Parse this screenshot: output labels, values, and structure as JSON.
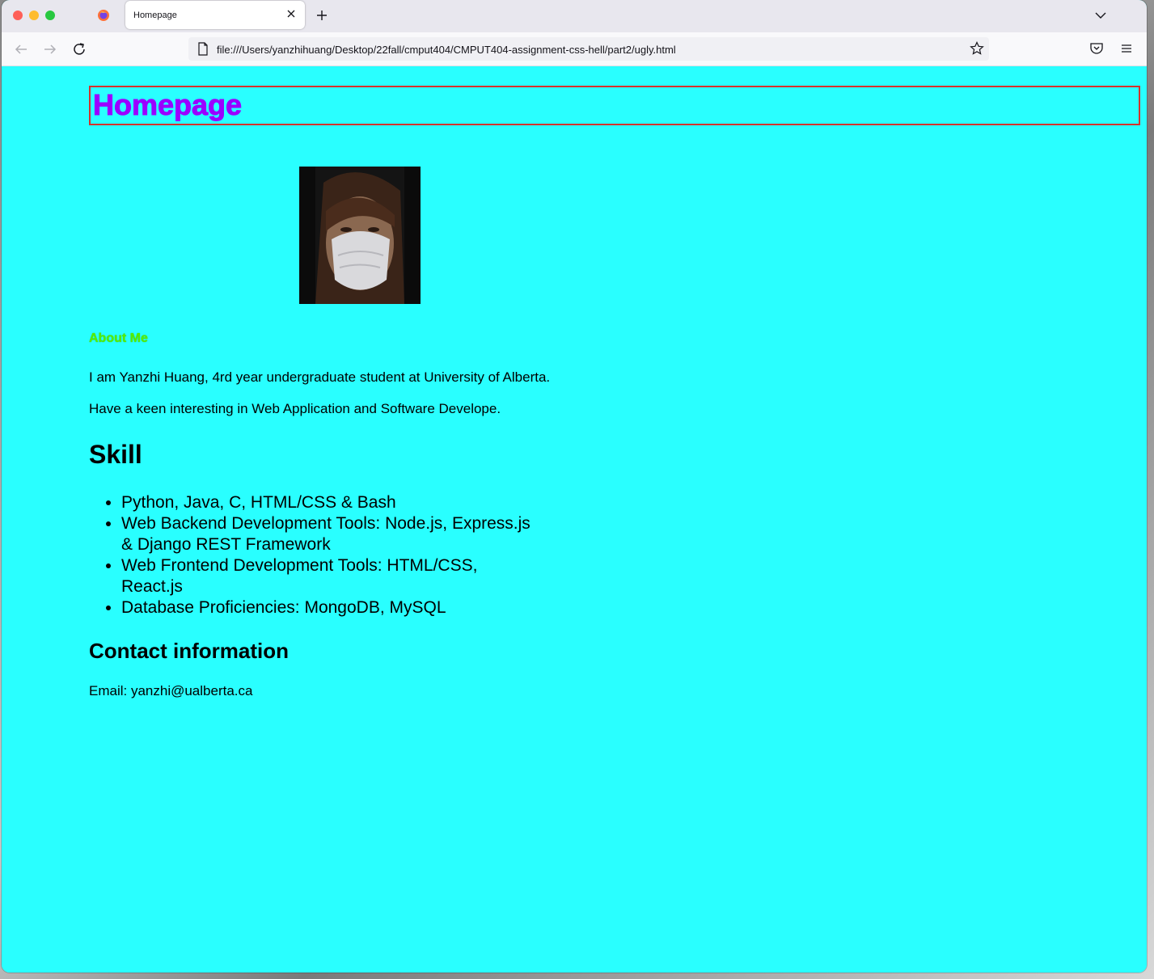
{
  "browser": {
    "tab_title": "Homepage",
    "url": "file:///Users/yanzhihuang/Desktop/22fall/cmput404/CMPUT404-assignment-css-hell/part2/ugly.html"
  },
  "page": {
    "title": "Homepage",
    "about_heading": "About Me",
    "about_paragraphs": [
      "I am Yanzhi Huang, 4rd year undergraduate student at University of Alberta.",
      "Have a keen interesting in Web Application and Software Develope."
    ],
    "skill_heading": "Skill",
    "skills": [
      "Python, Java, C, HTML/CSS & Bash",
      "Web Backend Development Tools: Node.js, Express.js & Django REST Framework",
      "Web Frontend Development Tools: HTML/CSS, React.js",
      "Database Proficiencies: MongoDB, MySQL"
    ],
    "contact_heading": "Contact information",
    "email": "Email: yanzhi@ualberta.ca"
  },
  "colors": {
    "page_background": "#29ffff",
    "title_color": "#9b00ff",
    "header_border": "#d4322b",
    "about_heading_color": "#55ee00"
  },
  "icons": [
    "firefox-icon",
    "close-icon",
    "plus-icon",
    "chevron-down-icon",
    "back-arrow-icon",
    "forward-arrow-icon",
    "reload-icon",
    "page-icon",
    "star-icon",
    "pocket-icon",
    "hamburger-menu-icon"
  ]
}
